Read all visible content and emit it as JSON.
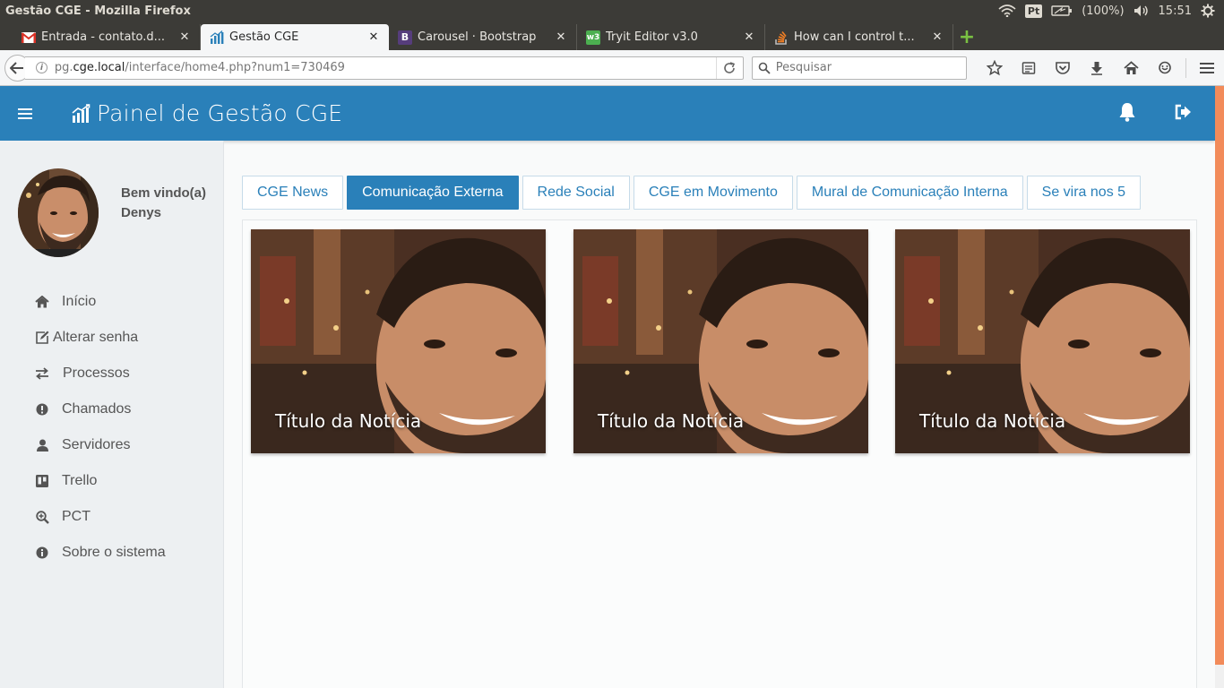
{
  "os": {
    "window_title": "Gestão CGE - Mozilla Firefox",
    "lang": "Pt",
    "battery": "(100%)",
    "clock": "15:51"
  },
  "browser": {
    "tabs": [
      {
        "label": "Entrada - contato.d...",
        "icon": "gmail-icon",
        "active": false
      },
      {
        "label": "Gestão CGE",
        "icon": "chart-favicon",
        "active": true
      },
      {
        "label": "Carousel · Bootstrap",
        "icon": "bootstrap-icon",
        "active": false
      },
      {
        "label": "Tryit Editor v3.0",
        "icon": "w3schools-icon",
        "active": false
      },
      {
        "label": "How can I control t...",
        "icon": "stackoverflow-icon",
        "active": false
      }
    ],
    "url_prefix": "pg.",
    "url_host": "cge.local",
    "url_path": "/interface/home4.php?num1=730469",
    "search_placeholder": "Pesquisar"
  },
  "app": {
    "brand_title": "Painel de Gestão CGE",
    "accent": "#2a80b9",
    "user": {
      "greeting": "Bem vindo(a)",
      "name": "Denys"
    },
    "menu": [
      {
        "label": "Início",
        "icon": "home-icon"
      },
      {
        "label": "Alterar senha",
        "icon": "edit-icon"
      },
      {
        "label": "Processos",
        "icon": "exchange-icon"
      },
      {
        "label": "Chamados",
        "icon": "alert-circle-icon"
      },
      {
        "label": "Servidores",
        "icon": "user-icon"
      },
      {
        "label": "Trello",
        "icon": "trello-icon"
      },
      {
        "label": "PCT",
        "icon": "zoom-icon"
      },
      {
        "label": "Sobre o sistema",
        "icon": "info-icon"
      }
    ],
    "content_tabs": [
      {
        "label": "CGE News",
        "active": false
      },
      {
        "label": "Comunicação Externa",
        "active": true
      },
      {
        "label": "Rede Social",
        "active": false
      },
      {
        "label": "CGE em Movimento",
        "active": false
      },
      {
        "label": "Mural de Comunicação Interna",
        "active": false
      },
      {
        "label": "Se vira nos 5",
        "active": false
      }
    ],
    "cards": [
      {
        "title": "Título da Notícia"
      },
      {
        "title": "Título da Notícia"
      },
      {
        "title": "Título da Notícia"
      }
    ]
  }
}
